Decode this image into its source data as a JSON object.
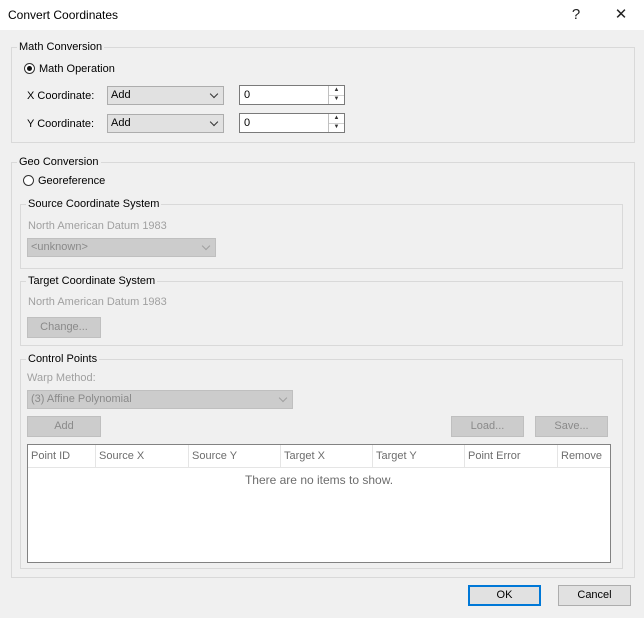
{
  "window": {
    "title": "Convert Coordinates",
    "help_glyph": "?",
    "close_glyph": "✕"
  },
  "math": {
    "group_label": "Math Conversion",
    "radio_label": "Math Operation",
    "x_label": "X Coordinate:",
    "x_op": "Add",
    "x_value": "0",
    "y_label": "Y Coordinate:",
    "y_op": "Add",
    "y_value": "0"
  },
  "geo": {
    "group_label": "Geo Conversion",
    "radio_label": "Georeference",
    "source": {
      "label": "Source Coordinate System",
      "datum": "North American Datum 1983",
      "combo": "<unknown>"
    },
    "target": {
      "label": "Target Coordinate System",
      "datum": "North American Datum 1983",
      "change_btn": "Change..."
    },
    "control": {
      "label": "Control Points",
      "warp_label": "Warp Method:",
      "warp_value": "(3) Affine Polynomial",
      "add_btn": "Add",
      "load_btn": "Load...",
      "save_btn": "Save...",
      "columns": [
        "Point ID",
        "Source X",
        "Source Y",
        "Target X",
        "Target Y",
        "Point Error",
        "Remove"
      ],
      "empty_text": "There are no items to show."
    }
  },
  "footer": {
    "ok": "OK",
    "cancel": "Cancel"
  }
}
